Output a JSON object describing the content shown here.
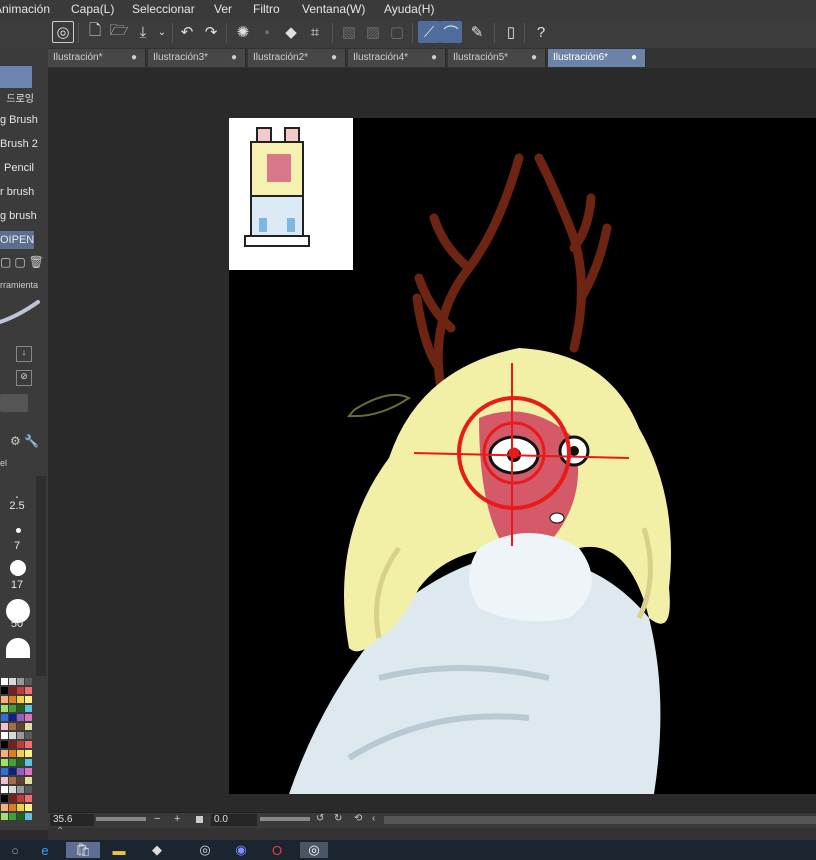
{
  "menubar": {
    "items": [
      "Animación",
      "Capa(L)",
      "Seleccionar",
      "Ver",
      "Filtro",
      "Ventana(W)",
      "Ayuda(H)"
    ]
  },
  "tabs": [
    {
      "label": "Ilustración*",
      "active": false
    },
    {
      "label": "Ilustración3*",
      "active": false
    },
    {
      "label": "Ilustración2*",
      "active": false
    },
    {
      "label": "Ilustración4*",
      "active": false
    },
    {
      "label": "Ilustración5*",
      "active": false
    },
    {
      "label": "Ilustración6*",
      "active": true
    }
  ],
  "tab_dot": "●",
  "left_panel": {
    "header_label": "드로잉",
    "brushes": [
      "g Brush",
      "Brush 2",
      "Pencil",
      "r brush",
      "g brush",
      "OIPEN"
    ],
    "tool_property_label": "rramienta",
    "layer_label": "el",
    "brush_sizes": [
      "2.5",
      "7",
      "17",
      "50"
    ]
  },
  "status": {
    "zoom": "35.6",
    "angle": "0.0"
  },
  "colors": {
    "accent": "#6d82a8",
    "canvas": "#000000",
    "hair": "#f2f0a6",
    "antler": "#6e2412",
    "skin": "#d45a6a",
    "reticle": "#e81a1a",
    "sweater": "#dde9ef"
  },
  "icons": [
    "clip-studio-icon",
    "new-file-icon",
    "open-folder-icon",
    "save-icon",
    "undo-icon",
    "redo-icon",
    "loading-icon",
    "select-icon",
    "fill-icon",
    "transform-icon",
    "ruler-icon",
    "help-icon"
  ]
}
